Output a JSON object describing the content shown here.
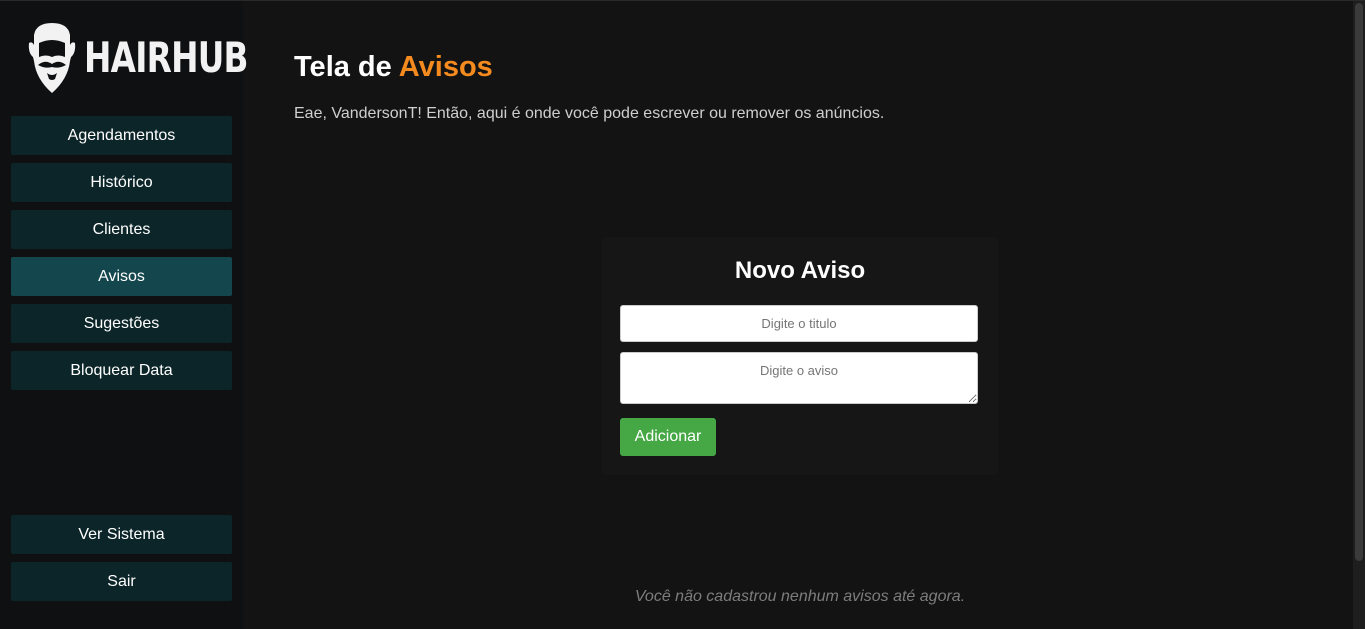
{
  "brand": {
    "name": "HAIRHUB",
    "logo_icon": "bearded-man-icon"
  },
  "sidebar": {
    "items": [
      {
        "label": "Agendamentos",
        "active": false
      },
      {
        "label": "Histórico",
        "active": false
      },
      {
        "label": "Clientes",
        "active": false
      },
      {
        "label": "Avisos",
        "active": true
      },
      {
        "label": "Sugestões",
        "active": false
      },
      {
        "label": "Bloquear Data",
        "active": false
      }
    ],
    "bottom_items": [
      {
        "label": "Ver Sistema"
      },
      {
        "label": "Sair"
      }
    ]
  },
  "main": {
    "title_prefix": "Tela de",
    "title_accent": "Avisos",
    "subtitle": "Eae, VandersonT! Então, aqui é onde você pode escrever ou remover os anúncios.",
    "form": {
      "heading": "Novo Aviso",
      "title_placeholder": "Digite o titulo",
      "title_value": "",
      "aviso_placeholder": "Digite o aviso",
      "aviso_value": "",
      "submit_label": "Adicionar"
    },
    "empty_message": "Você não cadastrou nenhum avisos até agora."
  },
  "colors": {
    "accent": "#f58a1f",
    "nav_bg": "#0c2529",
    "nav_active_bg": "#14464e",
    "submit_bg": "#45a845",
    "page_bg": "#131313"
  }
}
